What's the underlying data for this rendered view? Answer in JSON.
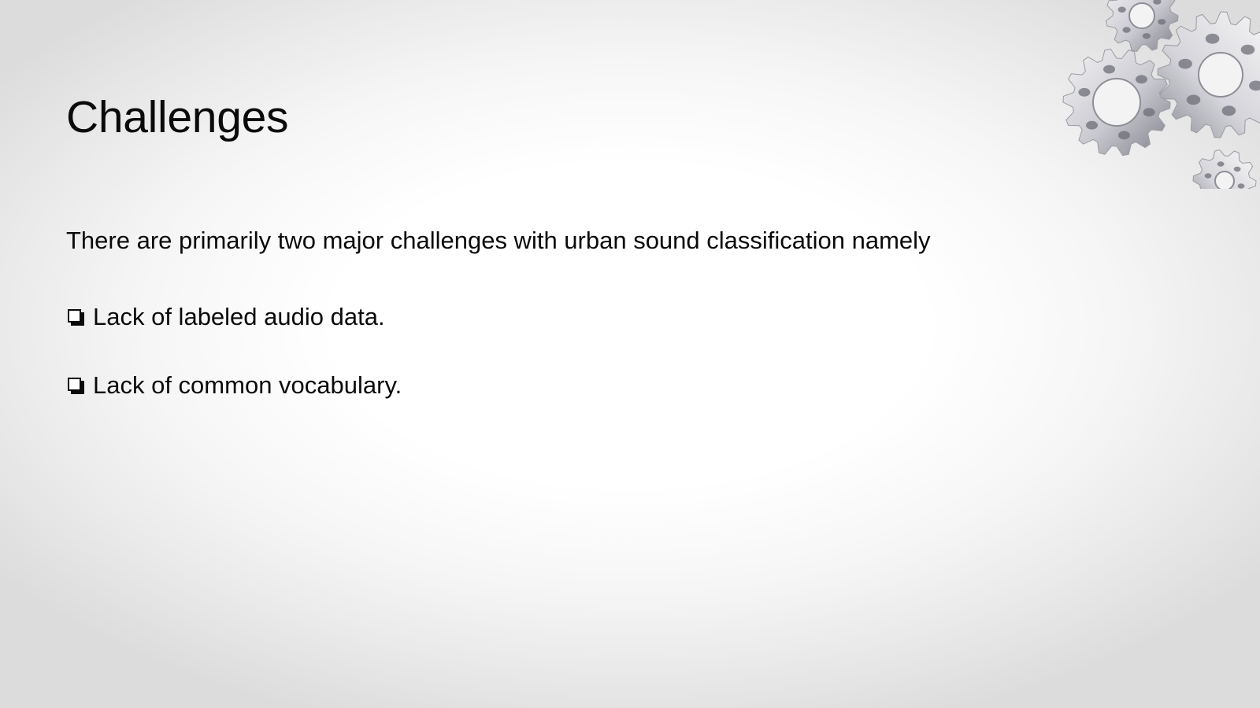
{
  "slide": {
    "title": "Challenges",
    "intro": "There are primarily two major challenges with urban sound classification namely",
    "bullets": [
      {
        "icon": "checkbox-square-icon",
        "text": "Lack of labeled audio data."
      },
      {
        "icon": "checkbox-square-icon",
        "text": "Lack of common vocabulary."
      }
    ],
    "decoration": {
      "icon": "gears-icon"
    }
  },
  "colors": {
    "text": "#0a0a0a",
    "background": "#ffffff",
    "gear_light": "#e8e8ec",
    "gear_dark": "#8a8a94"
  }
}
